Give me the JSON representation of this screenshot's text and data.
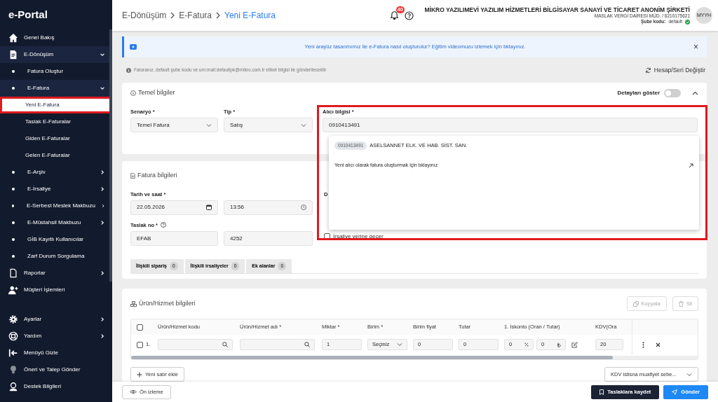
{
  "sidebar": {
    "logo": "e-Portal",
    "items": [
      {
        "label": "Genel Bakış",
        "expandable": false,
        "expanded": false,
        "selected": false,
        "annotated": false
      },
      {
        "label": "E-Dönüşüm",
        "expandable": true,
        "expanded": true,
        "selected": false,
        "annotated": false,
        "children": [
          {
            "label": "Fatura Oluştur",
            "expandable": false,
            "expanded": false,
            "selected": false,
            "annotated": false
          },
          {
            "label": "E-Fatura",
            "expandable": true,
            "expanded": true,
            "selected": false,
            "annotated": false,
            "children": [
              {
                "label": "Yeni E-Fatura",
                "expandable": false,
                "expanded": false,
                "selected": true,
                "annotated": true
              },
              {
                "label": "Taslak E-Faturalar",
                "expandable": false,
                "expanded": false,
                "selected": false,
                "annotated": false
              },
              {
                "label": "Giden E-Faturalar",
                "expandable": false,
                "expanded": false,
                "selected": false,
                "annotated": false
              },
              {
                "label": "Gelen E-Faturalar",
                "expandable": false,
                "expanded": false,
                "selected": false,
                "annotated": false
              }
            ]
          },
          {
            "label": "E-Arşiv",
            "expandable": true,
            "expanded": false,
            "selected": false,
            "annotated": false
          },
          {
            "label": "E-İrsaliye",
            "expandable": true,
            "expanded": false,
            "selected": false,
            "annotated": false
          },
          {
            "label": "E-Serbest Meslek Makbuzu",
            "expandable": true,
            "expanded": false,
            "selected": false,
            "annotated": false
          },
          {
            "label": "E-Müstahsil Makbuzu",
            "expandable": true,
            "expanded": false,
            "selected": false,
            "annotated": false
          },
          {
            "label": "GİB Kayıtlı Kullanıcılar",
            "expandable": false,
            "expanded": false,
            "selected": false,
            "annotated": false
          },
          {
            "label": "Zarf Durum Sorgulama",
            "expandable": false,
            "expanded": false,
            "selected": false,
            "annotated": false
          }
        ]
      },
      {
        "label": "Raporlar",
        "expandable": true,
        "expanded": false,
        "selected": false,
        "annotated": false
      },
      {
        "label": "Müşteri İşlemleri",
        "expandable": false,
        "expanded": false,
        "selected": false,
        "annotated": false
      }
    ],
    "bottom_items": [
      {
        "label": "Ayarlar",
        "expandable": true,
        "expanded": false,
        "selected": false,
        "annotated": false
      },
      {
        "label": "Yardım",
        "expandable": true,
        "expanded": false,
        "selected": false,
        "annotated": false
      },
      {
        "label": "Menüyü Gizle",
        "expandable": false,
        "expanded": false,
        "selected": false,
        "annotated": false
      },
      {
        "label": "Öneri ve Talep Gönder",
        "expandable": false,
        "expanded": false,
        "selected": false,
        "annotated": false
      },
      {
        "label": "Destek Bilgileri",
        "expandable": false,
        "expanded": false,
        "selected": false,
        "annotated": false
      }
    ]
  },
  "header": {
    "breadcrumb": [
      "E-Dönüşüm",
      "E-Fatura",
      "Yeni E-Fatura"
    ],
    "notification_count": "40",
    "company": "MİKRO YAZILIMEVİ YAZILIM HİZMETLERİ BİLGİSAYAR SANAYİ VE TİCARET ANONİM ŞİRKETİ",
    "tax_office": "MASLAK VERGİ DAİRESİ MÜD. / 6210175621",
    "branch_label": "Şube kodu:",
    "branch_value": "default",
    "branch_ok": true,
    "avatar": "MYYH"
  },
  "banner": {
    "text": "Yeni arayüz tasarımımız ile e-Fatura nasıl oluşturulur? Eğitim videomuzu izlemek için tıklayınız.",
    "close": "×"
  },
  "info_line": {
    "text": "Faturanız, default şube kodu ve urn:mail:defaultpk@mikro.com.tr etiket bilgisi ile gönderilecektir",
    "action": "Hesap/Seri Değiştir"
  },
  "basic_info": {
    "title": "Temel bilgiler",
    "details_label": "Detayları göster",
    "details_on": false,
    "scenario": {
      "label": "Senaryo *",
      "value": "Temel Fatura"
    },
    "type": {
      "label": "Tip *",
      "value": "Satış"
    },
    "recipient": {
      "label": "Alıcı bilgisi *",
      "value": "0910413491",
      "annotated": true,
      "suggestions": [
        {
          "code": "0910413491",
          "name": "ASELSANNET ELK. VE HAB. SİST. SAN."
        }
      ],
      "new_recipient": "Yeni alıcı olarak fatura oluşturmak için tıklayınız"
    }
  },
  "invoice_info": {
    "title": "Fatura bilgileri",
    "date_label": "Tarih ve saat *",
    "date": "22.05.2026",
    "time": "13:56",
    "draft_label": "Taslak no *",
    "draft_prefix": "EFAB",
    "draft_number": "4252",
    "column_3_label": "D",
    "waybill_label": "İrsaliye yerine geçer",
    "waybill_checked": false,
    "tabs": [
      {
        "label": "İlişkili sipariş",
        "count": "0",
        "selected": false
      },
      {
        "label": "İlişkili irsaliyeler",
        "count": "0",
        "selected": false
      },
      {
        "label": "Ek alanlar",
        "count": "0",
        "selected": false
      }
    ]
  },
  "products": {
    "title": "Ürün/Hizmet bilgileri",
    "copy": "Kopyala",
    "delete": "Sil",
    "table": {
      "all_checked": false,
      "columns": [
        "Ürün/Hizmet kodu",
        "Ürün/Hizmet adı *",
        "Miktar *",
        "Birim *",
        "Birim fiyat",
        "Tutar",
        "1. İskonto (Oran / Tutar)",
        "KDV(Ora"
      ],
      "rows": [
        {
          "checked": false,
          "number": "1.",
          "code": "",
          "name": "",
          "quantity": "1",
          "unit": "Seçiniz",
          "unit_price": "0",
          "amount": "0",
          "discount_rate": "0",
          "discount_amount": "0",
          "vat": "20"
        }
      ]
    },
    "add_row": "Yeni satır ekle",
    "vat_exemption": "KDV istisna muafiyet sebe..."
  },
  "footer": {
    "preview": "Ön izleme",
    "save_draft": "Taslaklara kaydet",
    "send": "Gönder"
  }
}
